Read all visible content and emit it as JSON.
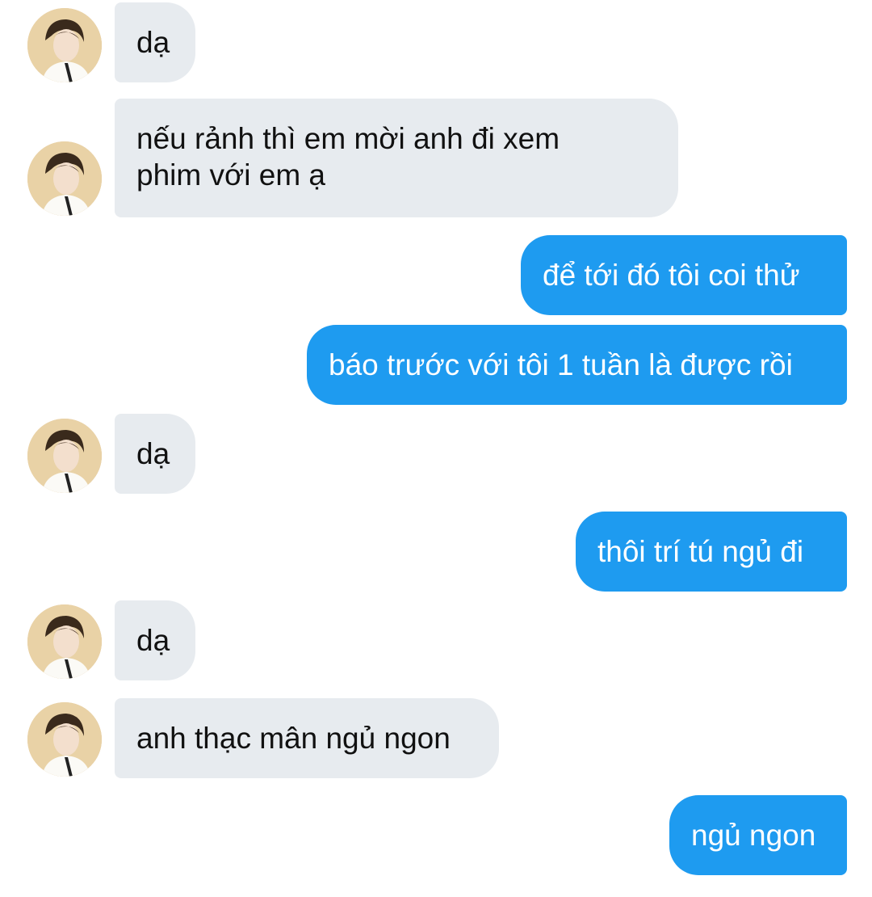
{
  "conversation": {
    "messages": [
      {
        "direction": "incoming",
        "text": "dạ",
        "avatar": "contact-avatar"
      },
      {
        "direction": "incoming",
        "text": "nếu rảnh thì em mời anh đi xem\nphim với em ạ",
        "avatar": "contact-avatar"
      },
      {
        "direction": "outgoing",
        "text": "để tới đó tôi coi thử"
      },
      {
        "direction": "outgoing",
        "text": "báo trước với tôi 1 tuần là được rồi"
      },
      {
        "direction": "incoming",
        "text": "dạ",
        "avatar": "contact-avatar"
      },
      {
        "direction": "outgoing",
        "text": "thôi trí tú ngủ đi"
      },
      {
        "direction": "incoming",
        "text": "dạ",
        "avatar": "contact-avatar"
      },
      {
        "direction": "incoming",
        "text": "anh thạc mân ngủ ngon",
        "avatar": "contact-avatar"
      },
      {
        "direction": "outgoing",
        "text": "ngủ ngon"
      }
    ]
  },
  "colors": {
    "incoming_bubble": "#e7ebef",
    "outgoing_bubble": "#1e9bf0",
    "outgoing_text": "#ffffff",
    "incoming_text": "#111111"
  }
}
